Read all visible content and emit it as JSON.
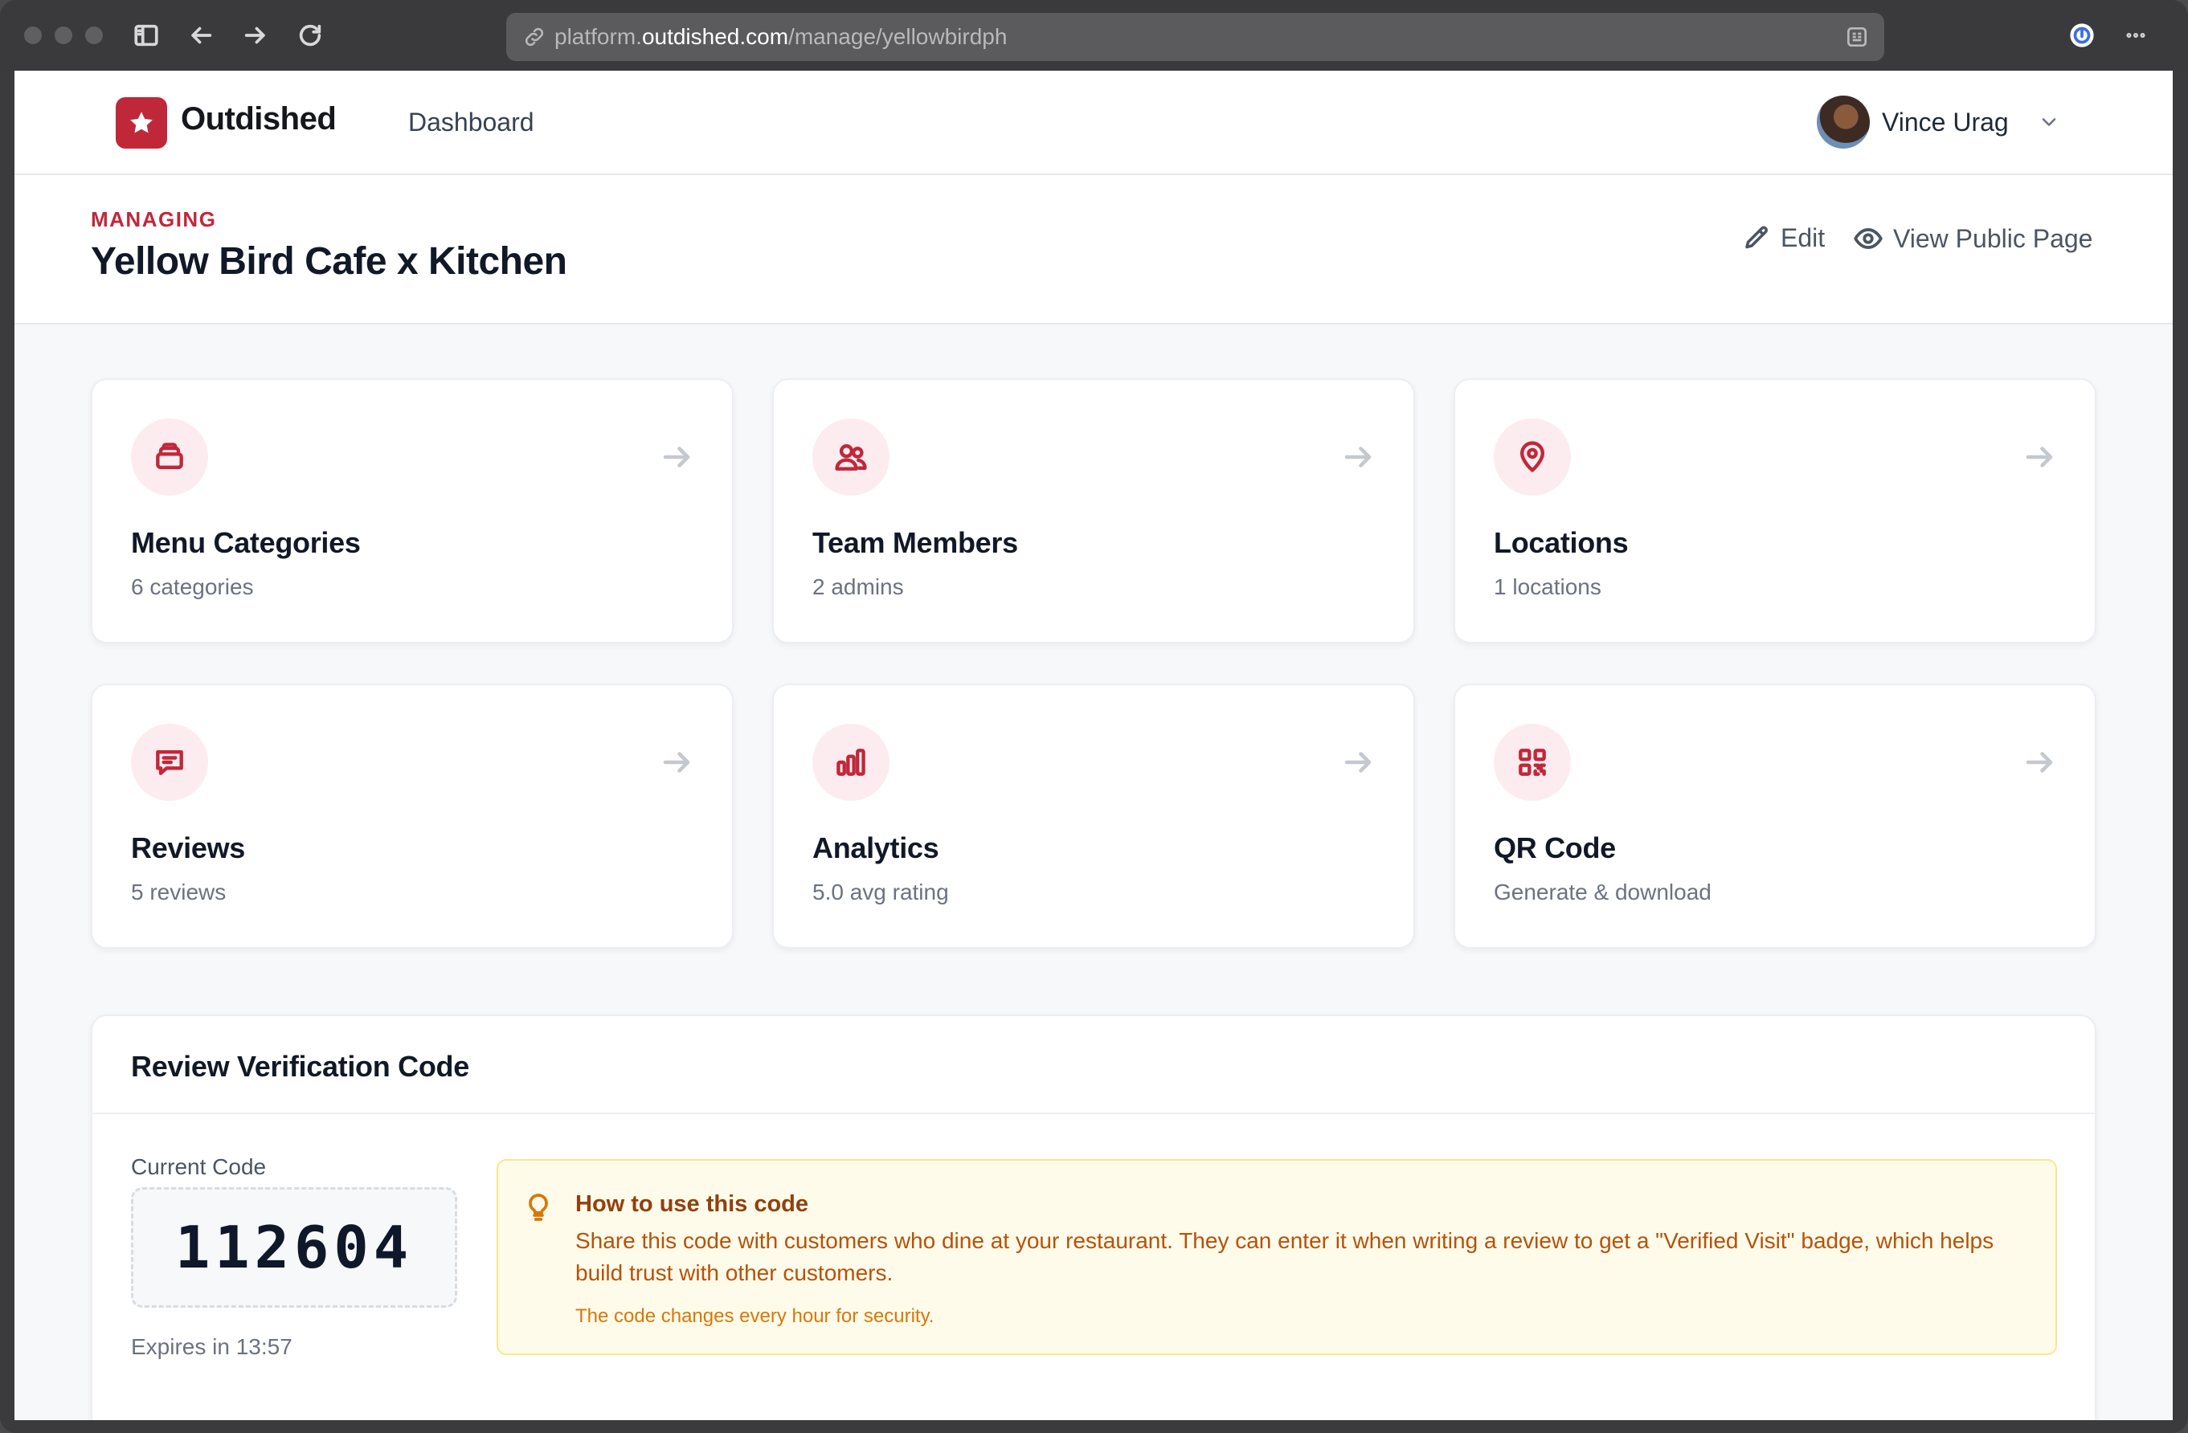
{
  "browser": {
    "url_prefix": "platform.",
    "url_host": "outdished.com",
    "url_path": "/manage/yellowbirdph"
  },
  "nav": {
    "brand": "Outdished",
    "links": [
      "Dashboard"
    ],
    "user_name": "Vince Urag"
  },
  "header": {
    "eyebrow": "MANAGING",
    "title": "Yellow Bird Cafe x Kitchen",
    "edit_label": "Edit",
    "view_public_label": "View Public Page"
  },
  "cards": [
    {
      "icon": "menu-stack-icon",
      "title": "Menu Categories",
      "subtitle": "6 categories"
    },
    {
      "icon": "users-icon",
      "title": "Team Members",
      "subtitle": "2 admins"
    },
    {
      "icon": "map-pin-icon",
      "title": "Locations",
      "subtitle": "1 locations"
    },
    {
      "icon": "message-icon",
      "title": "Reviews",
      "subtitle": "5 reviews"
    },
    {
      "icon": "bar-chart-icon",
      "title": "Analytics",
      "subtitle": "5.0 avg rating"
    },
    {
      "icon": "qr-code-icon",
      "title": "QR Code",
      "subtitle": "Generate & download"
    }
  ],
  "verification": {
    "title": "Review Verification Code",
    "code_label": "Current Code",
    "code": "112604",
    "expires": "Expires in 13:57",
    "tip_title": "How to use this code",
    "tip_body": "Share this code with customers who dine at your restaurant. They can enter it when writing a review to get a \"Verified Visit\" badge, which helps build trust with other customers.",
    "tip_note": "The code changes every hour for security."
  },
  "colors": {
    "brand": "#c0283a",
    "icon_bg": "#fdecef",
    "tip_bg": "#fffbeb",
    "tip_border": "#fde68a"
  }
}
